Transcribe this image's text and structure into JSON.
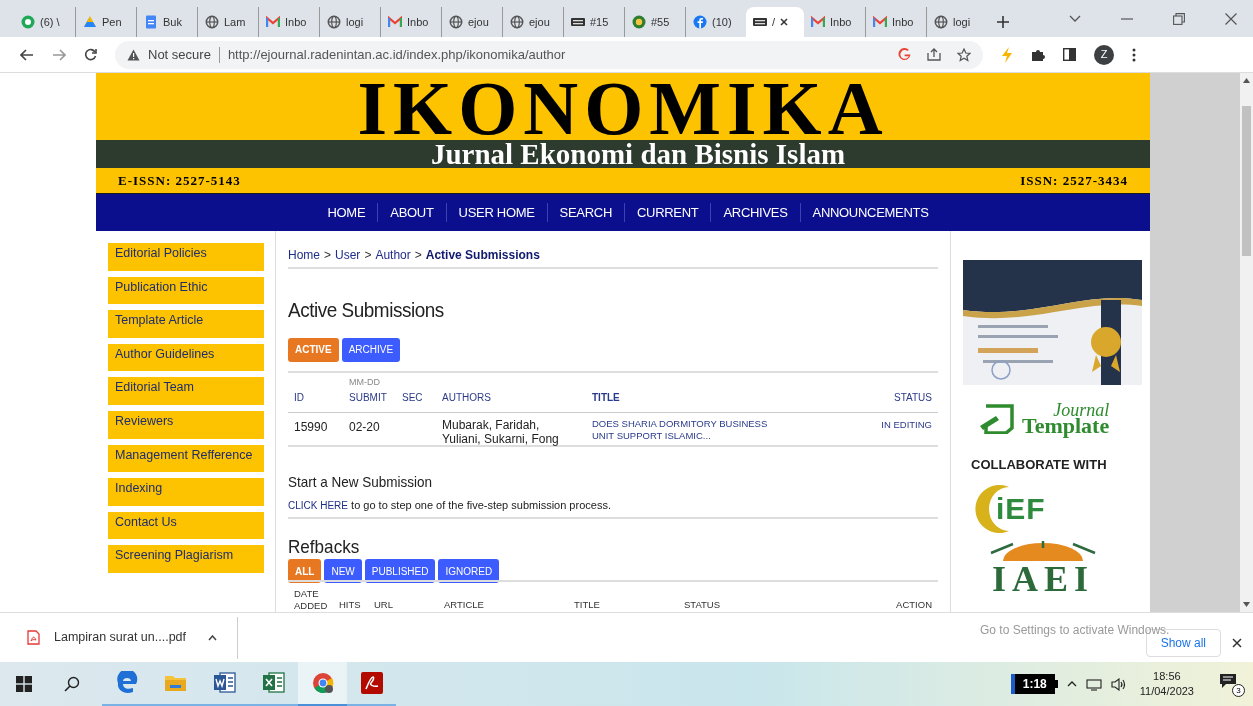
{
  "browser": {
    "tabs": [
      {
        "kind": "whatsapp",
        "title": "(6) \\",
        "selected": false
      },
      {
        "kind": "drive",
        "title": "Pen",
        "selected": false
      },
      {
        "kind": "docs",
        "title": "Buk",
        "selected": false
      },
      {
        "kind": "globe",
        "title": "Lam",
        "selected": false
      },
      {
        "kind": "gmail",
        "title": "Inbo",
        "selected": false
      },
      {
        "kind": "globe",
        "title": "logi",
        "selected": false
      },
      {
        "kind": "gmail",
        "title": "Inbo",
        "selected": false
      },
      {
        "kind": "globe",
        "title": "ejou",
        "selected": false
      },
      {
        "kind": "globe",
        "title": "ejou",
        "selected": false
      },
      {
        "kind": "pkp",
        "title": "#15",
        "selected": false
      },
      {
        "kind": "badge",
        "title": "#55",
        "selected": false
      },
      {
        "kind": "facebook",
        "title": "(10)",
        "selected": false
      },
      {
        "kind": "pkp",
        "title": "/",
        "selected": true
      },
      {
        "kind": "gmail",
        "title": "Inbo",
        "selected": false
      },
      {
        "kind": "gmail",
        "title": "Inbo",
        "selected": false
      },
      {
        "kind": "globe",
        "title": "logi",
        "selected": false
      }
    ],
    "security": "Not secure",
    "url": "http://ejournal.radenintan.ac.id/index.php/ikonomika/author",
    "profile_initial": "Z"
  },
  "banner": {
    "title": "IKONOMIKA",
    "subtitle": "Jurnal Ekonomi dan Bisnis Islam",
    "eissn": "E-ISSN: 2527-5143",
    "issn": "ISSN: 2527-3434"
  },
  "nav": [
    "HOME",
    "ABOUT",
    "USER HOME",
    "SEARCH",
    "CURRENT",
    "ARCHIVES",
    "ANNOUNCEMENTS"
  ],
  "sidebar": {
    "items": [
      "Editorial Policies",
      "Publication Ethic",
      "Template Article",
      "Author Guidelines",
      "Editorial Team",
      "Reviewers",
      "Management Refference",
      "Indexing",
      "Contact Us",
      "Screening Plagiarism"
    ]
  },
  "main": {
    "breadcrumb": [
      {
        "label": "Home",
        "separator": ">"
      },
      {
        "label": "User",
        "separator": ">"
      },
      {
        "label": "Author",
        "separator": ">"
      },
      {
        "label": "Active Submissions"
      }
    ],
    "heading": "Active Submissions",
    "filters": [
      {
        "label": "ACTIVE",
        "selected": true
      },
      {
        "label": "ARCHIVE",
        "selected": false
      }
    ],
    "columns": [
      {
        "label": "ID"
      },
      {
        "top": "MM-DD",
        "label": "SUBMIT"
      },
      {
        "label": "SEC"
      },
      {
        "label": "AUTHORS"
      },
      {
        "label": "TITLE"
      },
      {
        "label": "STATUS"
      }
    ],
    "rows": [
      [
        "15990",
        "02-20",
        "",
        "Mubarak, Faridah, Yuliani, Sukarni, Fong",
        "DOES SHARIA DORMITORY BUSINESS UNIT SUPPORT ISLAMIC...",
        "IN EDITING"
      ]
    ],
    "new_submission": {
      "heading": "Start a New Submission",
      "link": "CLICK HERE",
      "text": " to go to step one of the five-step submission process."
    },
    "refbacks": {
      "heading": "Refbacks",
      "filters": [
        {
          "label": "ALL",
          "selected": true
        },
        {
          "label": "NEW",
          "selected": false
        },
        {
          "label": "PUBLISHED",
          "selected": false
        },
        {
          "label": "IGNORED",
          "selected": false
        }
      ],
      "columns": [
        "DATE ADDED",
        "HITS",
        "URL",
        "ARTICLE",
        "TITLE",
        "STATUS",
        "ACTION"
      ]
    }
  },
  "right": {
    "journal_template": {
      "script": "Journal",
      "word": "Template"
    },
    "collaborate_heading": "COLLABORATE WITH",
    "partners": [
      "iEF",
      "IAEI"
    ]
  },
  "downloads": {
    "file": "Lampiran surat un....pdf",
    "show_all": "Show all"
  },
  "windows_notice": "Go to Settings to activate Windows.",
  "taskbar": {
    "apps": [
      {
        "kind": "edge",
        "active": false
      },
      {
        "kind": "explorer",
        "active": false
      },
      {
        "kind": "word",
        "active": false
      },
      {
        "kind": "excel",
        "active": false
      },
      {
        "kind": "chrome",
        "active": true
      },
      {
        "kind": "acrobat",
        "active": false
      }
    ],
    "battery": "1:18",
    "time": "18:56",
    "date": "11/04/2023",
    "notifications": "3"
  }
}
